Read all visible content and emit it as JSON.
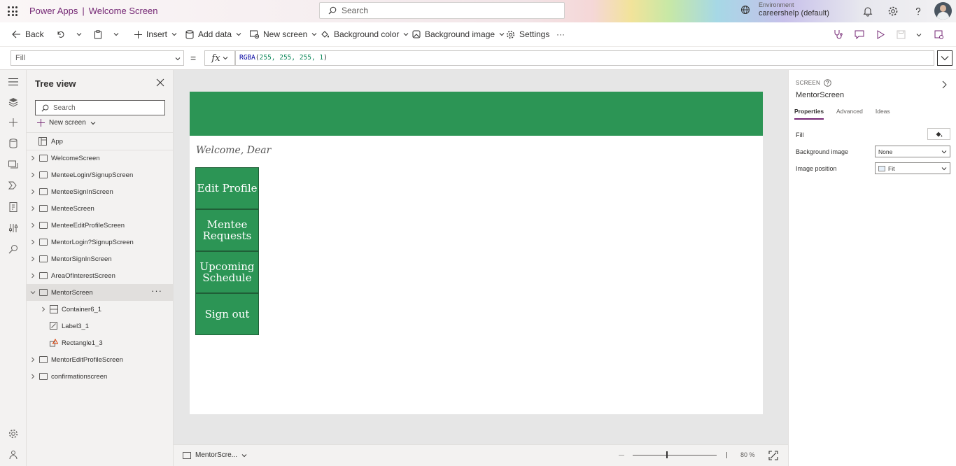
{
  "header": {
    "product": "Power Apps",
    "separator": "|",
    "app_name": "Welcome Screen",
    "search_placeholder": "Search",
    "environment_label": "Environment",
    "environment_value": "careershelp (default)"
  },
  "toolbar": {
    "back": "Back",
    "insert": "Insert",
    "add_data": "Add data",
    "new_screen": "New screen",
    "background_color": "Background color",
    "background_image": "Background image",
    "settings": "Settings",
    "more": "···"
  },
  "formula_bar": {
    "property": "Fill",
    "equals": "=",
    "fx": "fx",
    "formula_fn": "RGBA",
    "formula_open": "(",
    "formula_args": "255, 255, 255, 1",
    "formula_close": ")"
  },
  "tree": {
    "title": "Tree view",
    "search_placeholder": "Search",
    "new_screen": "New screen",
    "app_label": "App",
    "items": [
      {
        "label": "WelcomeScreen"
      },
      {
        "label": "MenteeLogin/SignupScreen"
      },
      {
        "label": "MenteeSignInScreen"
      },
      {
        "label": "MenteeScreen"
      },
      {
        "label": "MenteeEditProfileScreen"
      },
      {
        "label": "MentorLogin?SignupScreen"
      },
      {
        "label": "MentorSignInScreen"
      },
      {
        "label": "AreaOfInterestScreen"
      },
      {
        "label": "MentorScreen"
      },
      {
        "label": "Container6_1"
      },
      {
        "label": "Label3_1"
      },
      {
        "label": "Rectangle1_3"
      },
      {
        "label": "MentorEditProfileScreen"
      },
      {
        "label": "confirmationscreen"
      }
    ],
    "more": "···"
  },
  "canvas": {
    "welcome_text": "Welcome, Dear",
    "buttons": [
      {
        "label": "Edit Profile"
      },
      {
        "label": "Mentee Requests"
      },
      {
        "label": "Upcoming Schedule"
      },
      {
        "label": "Sign out"
      }
    ],
    "header_color": "#2c9555"
  },
  "bottom": {
    "screen_name": "MentorScre...",
    "zoom": "80 %"
  },
  "properties": {
    "kind": "SCREEN",
    "name": "MentorScreen",
    "tabs": [
      "Properties",
      "Advanced",
      "Ideas"
    ],
    "fill_label": "Fill",
    "background_image_label": "Background image",
    "background_image_value": "None",
    "image_position_label": "Image position",
    "image_position_value": "Fit"
  },
  "colors": {
    "brand": "#742774",
    "accent_green": "#2c9555"
  }
}
